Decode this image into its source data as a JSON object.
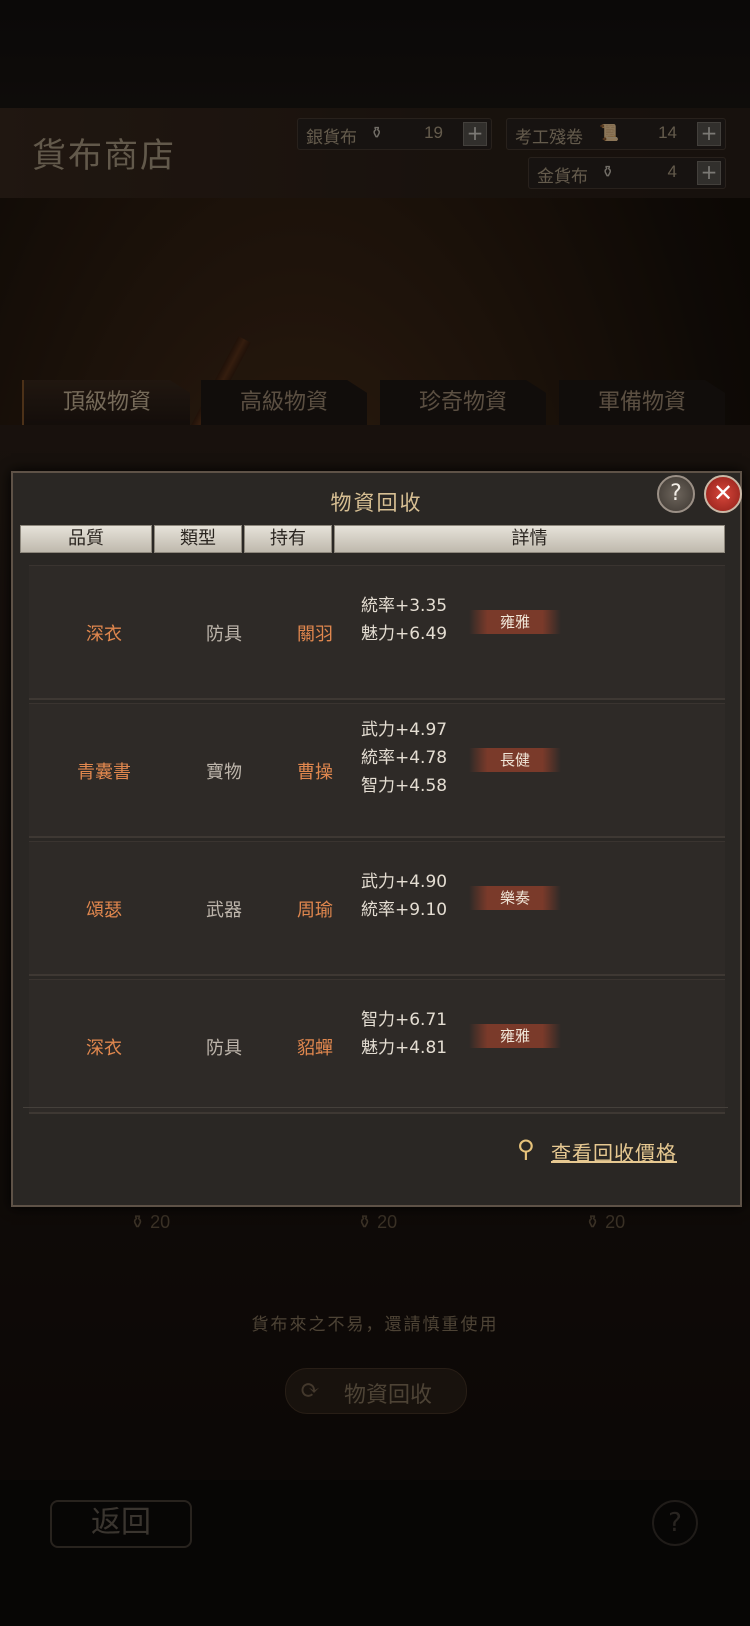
{
  "shop": {
    "title": "貨布商店",
    "resources": [
      {
        "label": "銀貨布",
        "value": "19"
      },
      {
        "label": "考工殘卷",
        "value": "14"
      },
      {
        "label": "金貨布",
        "value": "4"
      }
    ],
    "tabs": [
      "頂級物資",
      "高級物資",
      "珍奇物資",
      "軍備物資"
    ],
    "coin_values": [
      "20",
      "20",
      "20"
    ],
    "notice": "貨布來之不易，還請慎重使用",
    "recycle_button": "物資回收",
    "back_button": "返回"
  },
  "dialog": {
    "title": "物資回收",
    "headers": {
      "quality": "品質",
      "type": "類型",
      "owner": "持有",
      "detail": "詳情"
    },
    "rows": [
      {
        "name": "深衣",
        "type": "防具",
        "owner": "關羽",
        "stats": [
          "統率+3.35",
          "魅力+6.49"
        ],
        "tag": "雍雅"
      },
      {
        "name": "青囊書",
        "type": "寶物",
        "owner": "曹操",
        "stats": [
          "武力+4.97",
          "統率+4.78",
          "智力+4.58"
        ],
        "tag": "長健"
      },
      {
        "name": "頌瑟",
        "type": "武器",
        "owner": "周瑜",
        "stats": [
          "武力+4.90",
          "統率+9.10"
        ],
        "tag": "樂奏"
      },
      {
        "name": "深衣",
        "type": "防具",
        "owner": "貂蟬",
        "stats": [
          "智力+6.71",
          "魅力+4.81"
        ],
        "tag": "雍雅"
      }
    ],
    "price_link": "查看回收價格"
  },
  "icons": {
    "help": "?",
    "close": "✕",
    "plus": "+",
    "search": "⚲"
  },
  "colors": {
    "accent": "#e0874e",
    "gold": "#d7bf93",
    "close_red": "#c3352b"
  }
}
